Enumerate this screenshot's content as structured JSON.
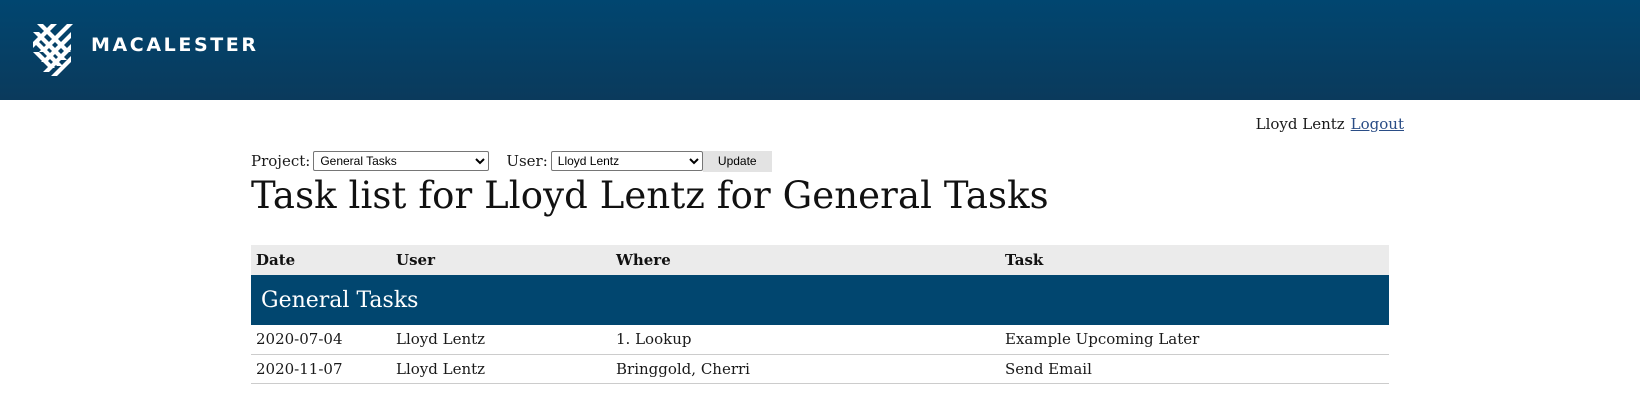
{
  "header": {
    "logo_text": "MACALESTER",
    "logo_icon": "macalester-plaid-logo-icon",
    "background_color": "#014670"
  },
  "user_bar": {
    "username": "Lloyd Lentz",
    "logout_label": "Logout"
  },
  "filters": {
    "project_label": "Project:",
    "project_selected": "General Tasks",
    "user_label": "User:",
    "user_selected": "Lloyd Lentz",
    "update_label": "Update"
  },
  "page_title": "Task list for Lloyd Lentz for General Tasks",
  "table": {
    "headers": [
      "Date",
      "User",
      "Where",
      "Task"
    ],
    "group_label": "General Tasks",
    "group_color": "#01466f",
    "rows": [
      {
        "date": "2020-07-04",
        "user": "Lloyd Lentz",
        "where": "1. Lookup",
        "task": "Example Upcoming Later"
      },
      {
        "date": "2020-11-07",
        "user": "Lloyd Lentz",
        "where": "Bringgold, Cherri",
        "task": "Send Email"
      }
    ]
  }
}
